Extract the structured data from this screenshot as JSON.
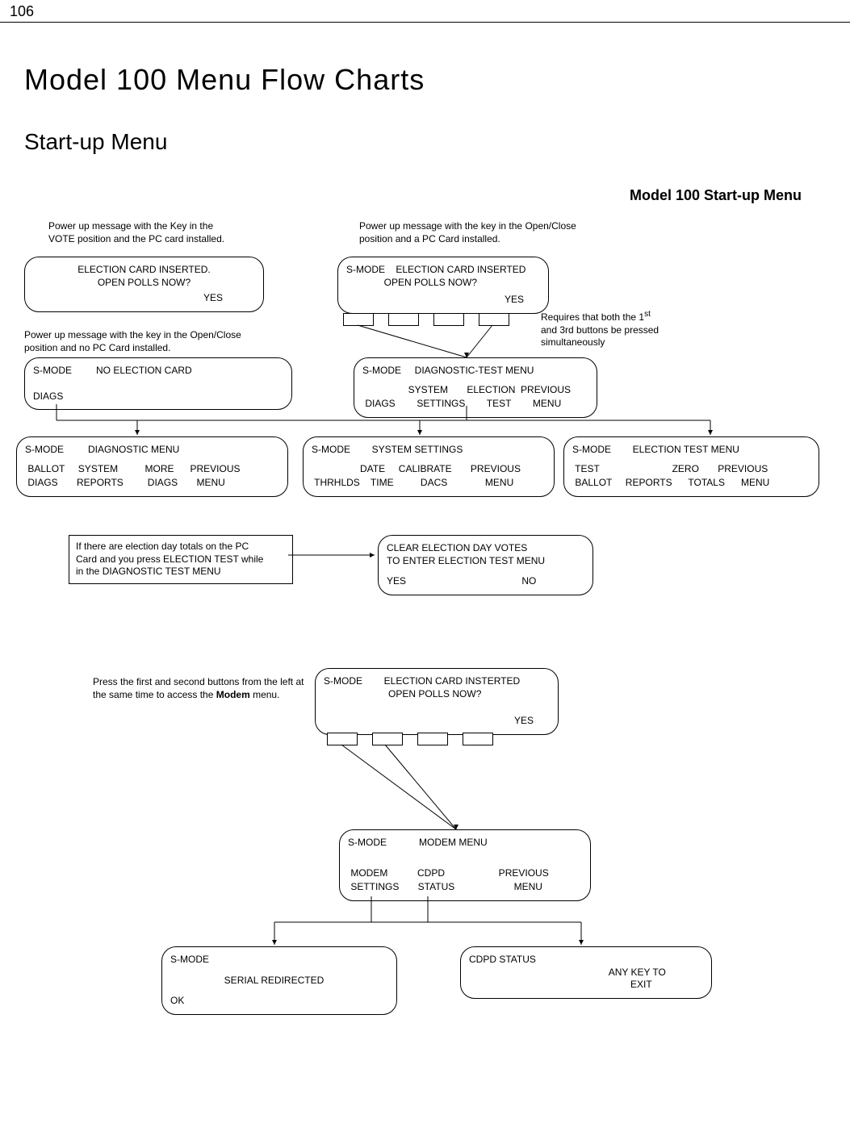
{
  "page_number": "106",
  "title": "Model 100 Menu Flow Charts",
  "subtitle": "Start-up Menu",
  "right_heading": "Model 100 Start-up Menu",
  "cap1": "Power up message with the Key in the\nVOTE position and the PC card installed.",
  "cap2": "Power up message with the key in the Open/Close\nposition and a PC Card installed.",
  "cap3": "Power up message with the key in the Open/Close\nposition and no PC Card installed.",
  "cap4_a": "Requires that both the 1",
  "cap4_sup": "st",
  "cap4_b": "and 3rd buttons be pressed\nsimultaneously",
  "cap5a": "Press the first and second buttons from the left at",
  "cap5b_pre": "the same time to access the ",
  "cap5b_bold": "Modem",
  "cap5b_post": " menu.",
  "box_vote_l1": "ELECTION CARD INSERTED.",
  "box_vote_l2": "OPEN POLLS NOW?",
  "box_vote_yes": "YES",
  "box_oc_l1": "S-MODE    ELECTION CARD INSERTED",
  "box_oc_l2": "              OPEN POLLS NOW?",
  "box_oc_yes": "YES",
  "box_nocard_l1": "S-MODE         NO ELECTION CARD",
  "box_nocard_l2": "DIAGS",
  "box_dtm_l1": "S-MODE     DIAGNOSTIC-TEST MENU",
  "box_dtm_l2": "                 SYSTEM       ELECTION  PREVIOUS",
  "box_dtm_l3": " DIAGS        SETTINGS        TEST        MENU",
  "box_diag_l1": "S-MODE         DIAGNOSTIC MENU",
  "box_diag_l2": " BALLOT     SYSTEM          MORE      PREVIOUS",
  "box_diag_l3": " DIAGS       REPORTS         DIAGS       MENU",
  "box_sys_l1": "S-MODE        SYSTEM SETTINGS",
  "box_sys_l2": "                  DATE     CALIBRATE       PREVIOUS",
  "box_sys_l3": " THRHLDS    TIME          DACS              MENU",
  "box_etm_l1": "S-MODE        ELECTION TEST MENU",
  "box_etm_l2": " TEST                           ZERO       PREVIOUS",
  "box_etm_l3": " BALLOT     REPORTS      TOTALS      MENU",
  "note_if_l1": "If there are election day totals on the PC",
  "note_if_l2": "Card and you press ELECTION TEST while",
  "note_if_l3": "in the DIAGNOSTIC TEST MENU",
  "box_clear_l1": "CLEAR ELECTION DAY VOTES",
  "box_clear_l2": "TO ENTER ELECTION TEST MENU",
  "box_clear_l3": "YES                                           NO",
  "box_modem_entry_l1": "S-MODE        ELECTION CARD INSTERTED",
  "box_modem_entry_l2": "                        OPEN POLLS NOW?",
  "box_modem_entry_yes": "YES",
  "box_modem_menu_l1": "S-MODE            MODEM MENU",
  "box_modem_menu_l2": " MODEM           CDPD                    PREVIOUS",
  "box_modem_menu_l3": " SETTINGS       STATUS                      MENU",
  "box_serial_l1": "S-MODE",
  "box_serial_l2": "                    SERIAL REDIRECTED",
  "box_serial_l3": "OK",
  "box_cdpd_l1": "CDPD STATUS",
  "box_cdpd_l2": "                                                    ANY KEY TO",
  "box_cdpd_l3": "                                                            EXIT"
}
